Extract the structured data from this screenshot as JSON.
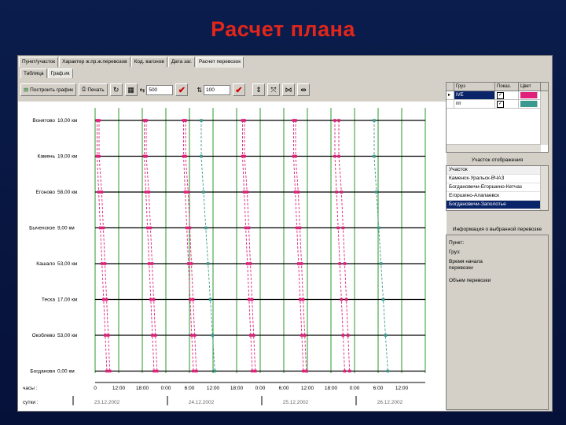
{
  "slide": {
    "title": "Расчет плана"
  },
  "tabs": [
    "Пункт/участок",
    "Характер ж.пр.ж.перевозов",
    "Код. вагонов",
    "Дата заг.",
    "Расчет перевозок"
  ],
  "subtabs": [
    "Таблица",
    "Граф.ик"
  ],
  "toolbar": {
    "build_graph_label": "Построить график",
    "print_label": "Печать",
    "scale1_value": "500",
    "scale2_value": "100"
  },
  "right_panel": {
    "table_headers": [
      "Груз",
      "Показ.",
      "Цвет"
    ],
    "table_rows": [
      {
        "name": "IVE",
        "shown": true,
        "color": "#e0207a"
      },
      {
        "name": "пп",
        "shown": true,
        "color": "#3a9a8e"
      }
    ],
    "display_section_title": "Участок отображения",
    "display_items": [
      "Участок",
      "Каменск-Уральск-ВЧАЗ",
      "Богдановичи-Егоршино-Кетчаз",
      "Егоршино-Алапаевск",
      "Богдановичи-Заполотье"
    ],
    "selected_display_index": 4,
    "info_section_title": "Информация о выбранной перевозке",
    "info_lines": [
      "Пункт:",
      "Груз:",
      "Время начала",
      "перевозки",
      "",
      "Объем перевозки"
    ]
  },
  "chart_data": {
    "type": "line",
    "stations": [
      {
        "name": "Вонятово",
        "km": "10,00 км"
      },
      {
        "name": "Камень",
        "km": "19,00 км"
      },
      {
        "name": "Егоново",
        "km": "58,00 км"
      },
      {
        "name": "Быченское",
        "km": "9,00 км"
      },
      {
        "name": "Кашало",
        "km": "53,00 км"
      },
      {
        "name": "Теска",
        "km": "17,00 км"
      },
      {
        "name": "Окоблево",
        "km": "53,00 км"
      },
      {
        "name": "Богданови",
        "km": "0,00 км"
      }
    ],
    "time_ticks": [
      "0",
      "12:00",
      "18:00",
      "0:00",
      "6:00",
      "12:00",
      "18:00",
      "0:00",
      "6:00",
      "12:00",
      "18:00",
      "0:00",
      "6:00",
      "12:00"
    ],
    "date_labels": [
      "23.12.2002",
      "24.12.2002",
      "25.12.2002",
      "26.12.2002"
    ],
    "bottom_labels": {
      "hours": "часы :",
      "dates": "сутки :"
    },
    "day_boundaries_hours": [
      12,
      36,
      60,
      84
    ],
    "series": [
      {
        "color": "#e0207a",
        "start_hours": [
          0.5,
          1.0
        ]
      },
      {
        "color": "#e0207a",
        "start_hours": [
          12.5,
          13.0
        ]
      },
      {
        "color": "#e0207a",
        "start_hours": [
          22.5,
          23.0
        ]
      },
      {
        "color": "#3a9a8e",
        "start_hours": [
          27.0
        ]
      },
      {
        "color": "#e0207a",
        "start_hours": [
          37.5,
          38.0
        ]
      },
      {
        "color": "#e0207a",
        "start_hours": [
          50.5,
          51.0
        ]
      },
      {
        "color": "#e0207a",
        "start_hours": [
          61.0,
          62.0
        ]
      },
      {
        "color": "#3a9a8e",
        "start_hours": [
          71.0
        ]
      }
    ],
    "x_range_hours": [
      0,
      84
    ]
  }
}
